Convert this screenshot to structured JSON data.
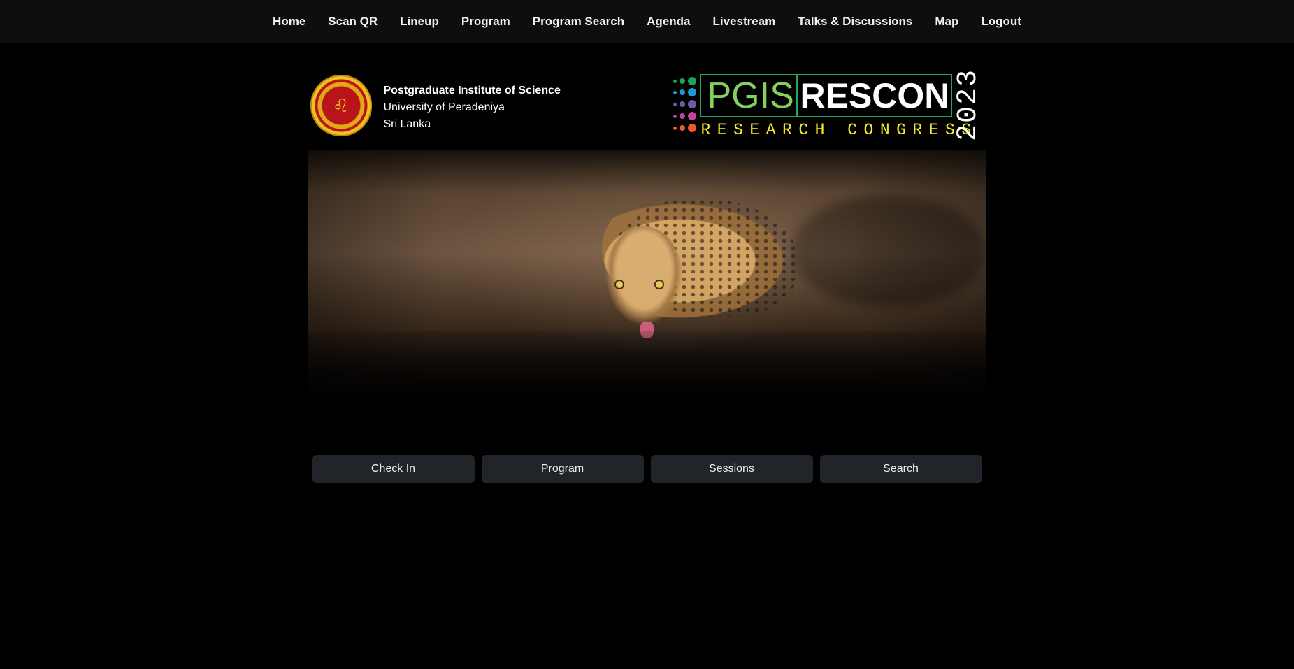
{
  "nav": {
    "items": [
      {
        "label": "Home"
      },
      {
        "label": "Scan QR"
      },
      {
        "label": "Lineup"
      },
      {
        "label": "Program"
      },
      {
        "label": "Program Search"
      },
      {
        "label": "Agenda"
      },
      {
        "label": "Livestream"
      },
      {
        "label": "Talks & Discussions"
      },
      {
        "label": "Map"
      },
      {
        "label": "Logout"
      }
    ]
  },
  "institution": {
    "line1": "Postgraduate Institute of Science",
    "line2": "University of Peradeniya",
    "line3": "Sri Lanka"
  },
  "brand": {
    "pgis": "PGIS",
    "rescon": "RESCON",
    "subtitle": "RESEARCH CONGRESS",
    "year": "2023",
    "colors": {
      "pgis": "#83d05d",
      "box": "#29a35c",
      "subtitle": "#f2ed26"
    }
  },
  "actions": [
    {
      "label": "Check In"
    },
    {
      "label": "Program"
    },
    {
      "label": "Sessions"
    },
    {
      "label": "Search"
    }
  ]
}
